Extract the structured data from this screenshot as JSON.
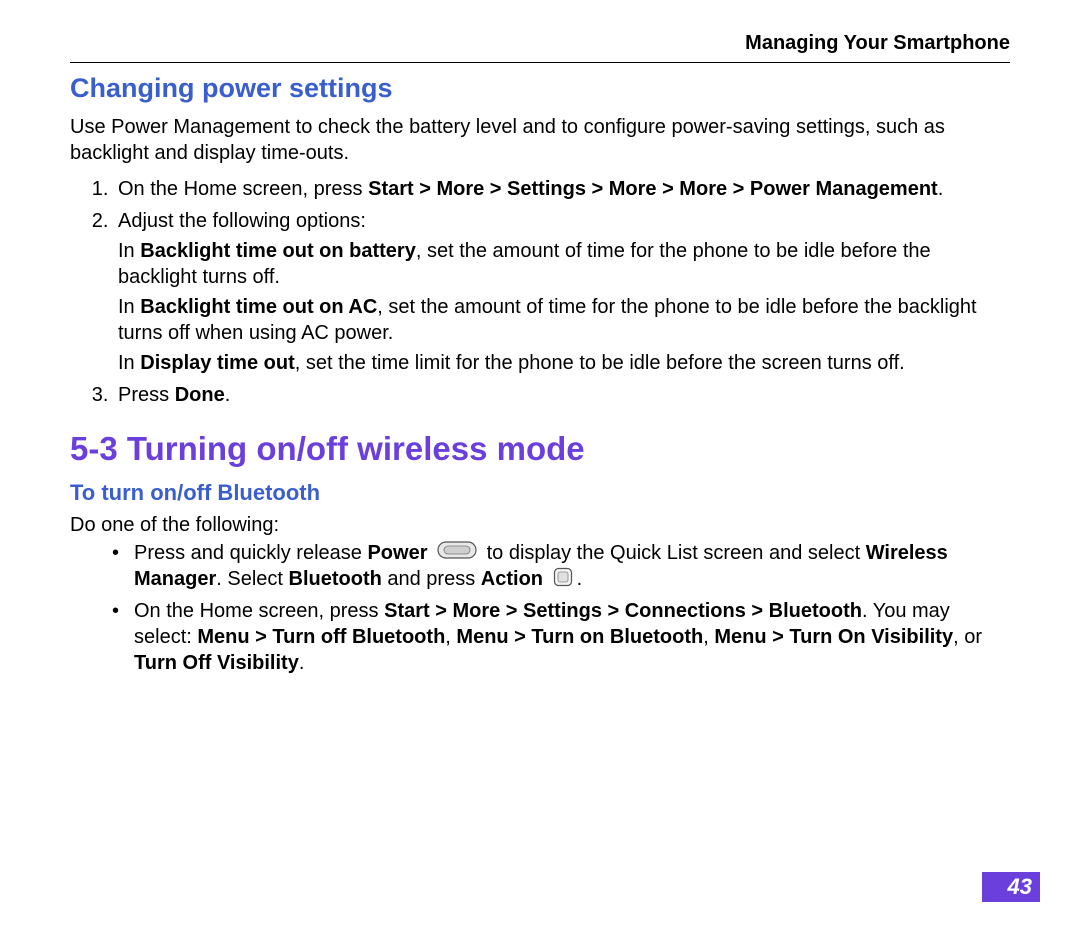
{
  "header": {
    "running_title": "Managing Your Smartphone"
  },
  "section1": {
    "heading": "Changing power settings",
    "intro": "Use Power Management to check the battery level and to configure power-saving settings, such as backlight and display time-outs.",
    "step1_pre": "On the Home screen, press ",
    "step1_bold": "Start  > More > Settings > More > More > Power Management",
    "step1_post": ".",
    "step2": "Adjust the following options:",
    "step2a_pre": "In ",
    "step2a_bold": "Backlight time out on battery",
    "step2a_post": ", set the amount of time for the phone to be idle before the backlight turns off.",
    "step2b_pre": "In ",
    "step2b_bold": "Backlight time out on AC",
    "step2b_post": ", set the amount of time for the phone to be idle before the backlight turns off when using AC power.",
    "step2c_pre": "In ",
    "step2c_bold": "Display time out",
    "step2c_post": ", set the time limit for the phone to be idle before the screen turns off.",
    "step3_pre": "Press ",
    "step3_bold": "Done",
    "step3_post": "."
  },
  "section2": {
    "number_heading": "5-3   Turning on/off wireless mode",
    "sub_heading": "To turn on/off Bluetooth",
    "intro": "Do one of the following:",
    "bullet1_pre": "Press and quickly release ",
    "bullet1_b1": "Power",
    "bullet1_mid1": " to display the Quick List screen and select ",
    "bullet1_b2": "Wireless Manager",
    "bullet1_mid2": ". Select ",
    "bullet1_b3": "Bluetooth",
    "bullet1_mid3": " and press ",
    "bullet1_b4": "Action",
    "bullet1_post": ".",
    "bullet2_pre": "On the Home screen, press ",
    "bullet2_b1": "Start  > More > Settings > Connections > Bluetooth",
    "bullet2_mid1": ". You may select: ",
    "bullet2_b2": "Menu > Turn off Bluetooth",
    "bullet2_sep1": ", ",
    "bullet2_b3": "Menu > Turn on Bluetooth",
    "bullet2_sep2": ", ",
    "bullet2_b4": "Menu > Turn On Visibility",
    "bullet2_mid2": ", or ",
    "bullet2_b5": "Turn Off Visibility",
    "bullet2_post": "."
  },
  "page_number": "43"
}
